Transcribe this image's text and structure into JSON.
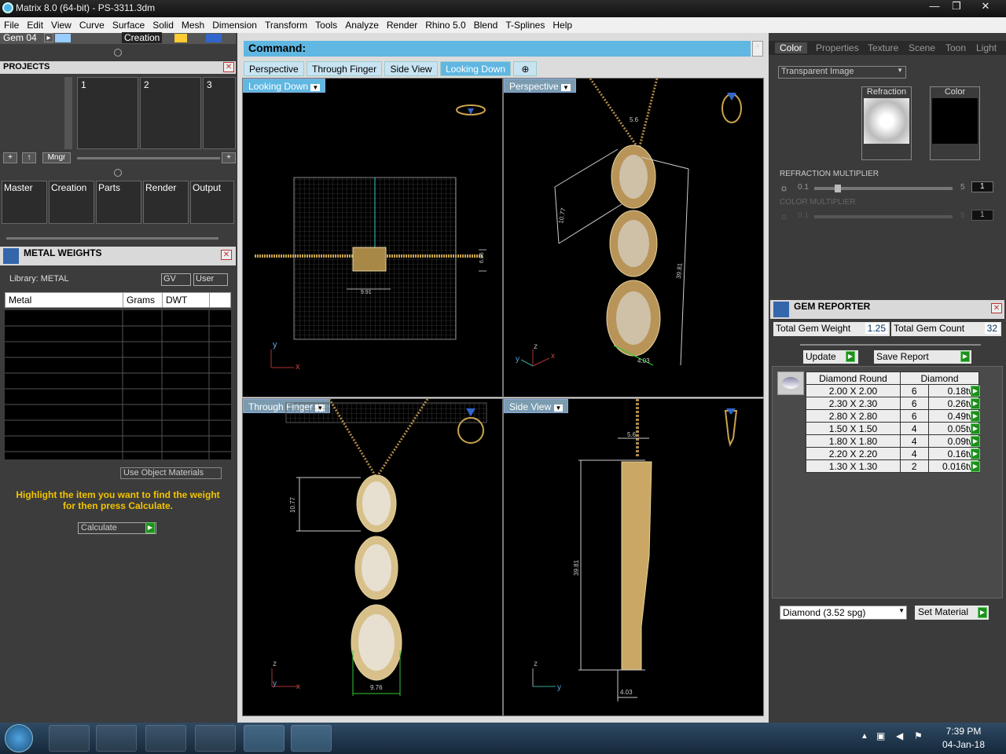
{
  "window": {
    "title": "Matrix 8.0 (64-bit) - PS-3311.3dm",
    "min": "—",
    "max": "❐",
    "close": "✕"
  },
  "menu": [
    "File",
    "Edit",
    "View",
    "Curve",
    "Surface",
    "Solid",
    "Mesh",
    "Dimension",
    "Transform",
    "Tools",
    "Analyze",
    "Render",
    "Rhino 5.0",
    "Blend",
    "T-Splines",
    "Help"
  ],
  "toolbar": {
    "gem_label": "Gem 04",
    "creation_label": "Creation"
  },
  "projects": {
    "title": "PROJECTS",
    "slots": [
      "1",
      "2",
      "3"
    ],
    "mngr": "Mngr"
  },
  "modes": [
    "Master",
    "Creation",
    "Parts",
    "Render",
    "Output"
  ],
  "metal": {
    "title": "METAL WEIGHTS",
    "library": "Library: METAL",
    "gv": "GV",
    "user": "User",
    "columns": [
      "Metal",
      "Grams",
      "DWT"
    ],
    "use_object_materials": "Use Object Materials",
    "hint": "Highlight the item you want to find the weight for then press Calculate.",
    "calculate": "Calculate"
  },
  "command": {
    "label": "Command:"
  },
  "view_tabs": [
    "Perspective",
    "Through Finger",
    "Side View",
    "Looking Down"
  ],
  "active_tab": "Looking Down",
  "viewports": {
    "tl": {
      "label": "Looking Down",
      "dim1": "9.91",
      "dim2": "6.86",
      "ax1": "y",
      "ax2": "x"
    },
    "tr": {
      "label": "Perspective",
      "dim1": "5.6",
      "dim2": "10.77",
      "dim3": "39.81",
      "dim4": "4.03",
      "ax1": "z",
      "ax2": "y",
      "ax3": "x"
    },
    "bl": {
      "label": "Through Finger",
      "dim1": "10.77",
      "dim2": "9.76",
      "ax1": "z",
      "ax2": "y",
      "ax3": "x"
    },
    "br": {
      "label": "Side View",
      "dim1": "5.6",
      "dim2": "39.81",
      "dim3": "4.03",
      "ax1": "z",
      "ax2": "y"
    }
  },
  "right_tabs": [
    "Color",
    "Properties",
    "Texture",
    "Scene",
    "Toon",
    "Light"
  ],
  "material": {
    "dropdown": "Transparent Image",
    "refraction": "Refraction",
    "color": "Color",
    "refraction_multiplier": "REFRACTION MULTIPLIER",
    "refr_min": "0.1",
    "refr_max": "5",
    "refr_value": "1",
    "color_multiplier": "COLOR MULTIPLIER",
    "col_min": "0.1",
    "col_max": "5",
    "col_value": "1"
  },
  "gem_reporter": {
    "title": "GEM REPORTER",
    "total_weight_label": "Total Gem Weight",
    "total_weight": "1.25",
    "total_count_label": "Total Gem Count",
    "total_count": "32",
    "update": "Update",
    "save_report": "Save Report",
    "col1": "Diamond Round",
    "col2": "Diamond",
    "rows": [
      {
        "size": "2.00 X 2.00",
        "count": "6",
        "wt": "0.18tw"
      },
      {
        "size": "2.30 X 2.30",
        "count": "6",
        "wt": "0.26tw"
      },
      {
        "size": "2.80 X 2.80",
        "count": "6",
        "wt": "0.49tw"
      },
      {
        "size": "1.50 X 1.50",
        "count": "4",
        "wt": "0.05tw"
      },
      {
        "size": "1.80 X 1.80",
        "count": "4",
        "wt": "0.09tw"
      },
      {
        "size": "2.20 X 2.20",
        "count": "4",
        "wt": "0.16tw"
      },
      {
        "size": "1.30 X 1.30",
        "count": "2",
        "wt": "0.016tw"
      }
    ],
    "material_select": "Diamond    (3.52 spg)",
    "set_material": "Set Material"
  },
  "taskbar": {
    "time": "7:39 PM",
    "date": "04-Jan-18"
  },
  "colors": {
    "accent": "#5fb7e2",
    "gold": "#c9a44e",
    "hint": "#f2c400"
  }
}
